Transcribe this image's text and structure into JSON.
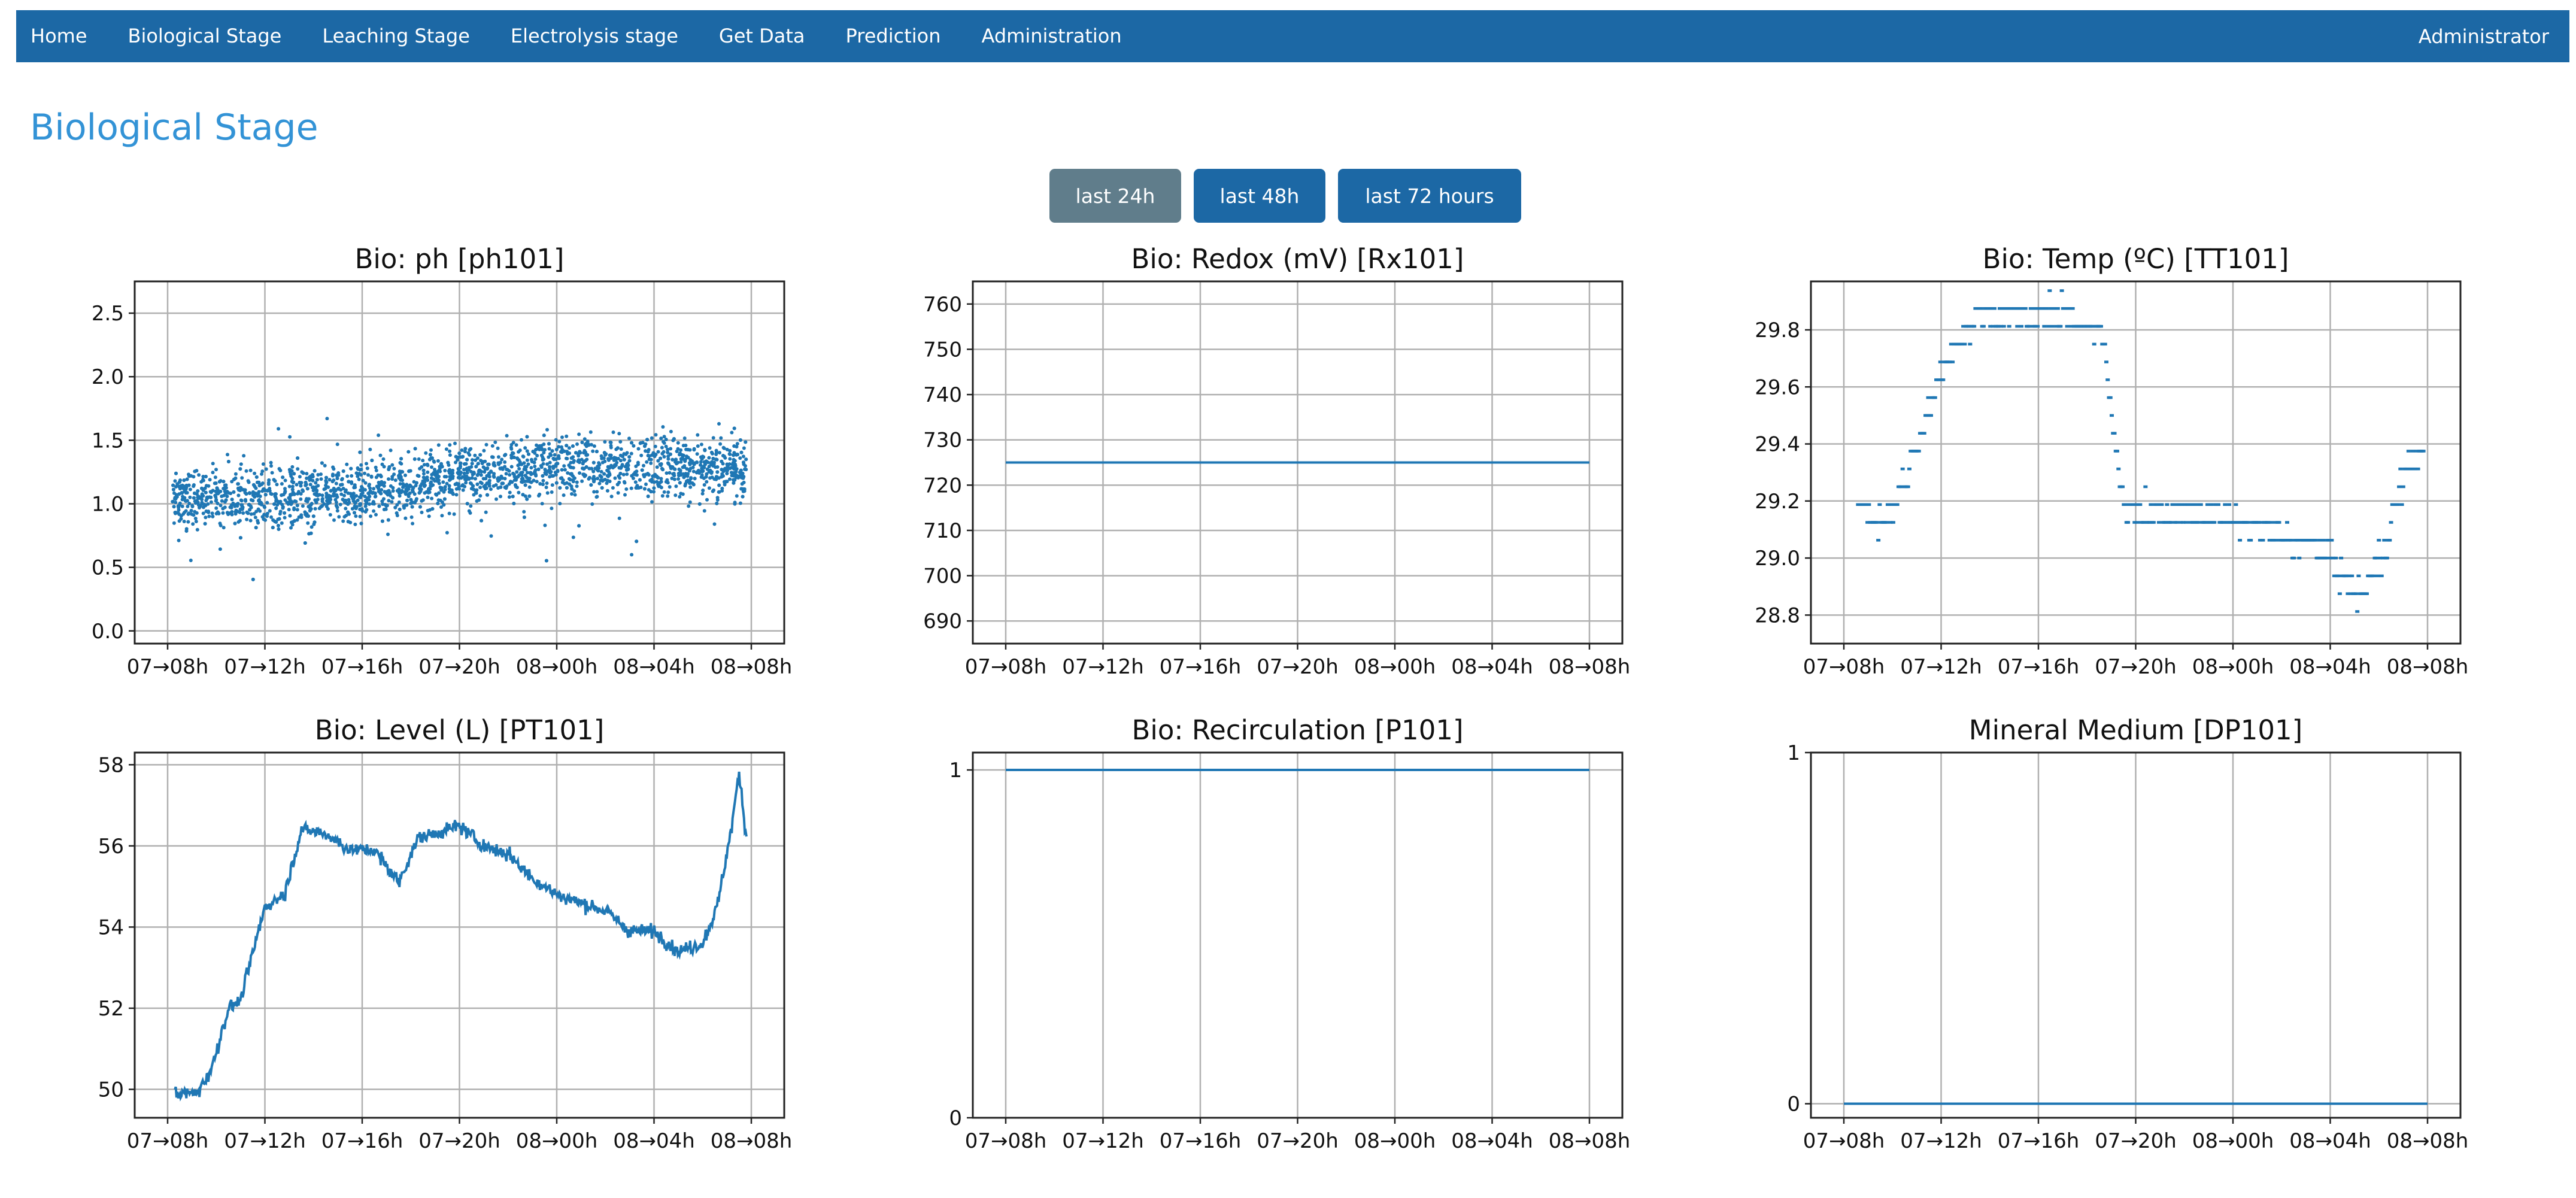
{
  "nav": {
    "items": [
      "Home",
      "Biological Stage",
      "Leaching Stage",
      "Electrolysis stage",
      "Get Data",
      "Prediction",
      "Administration"
    ],
    "user": "Administrator"
  },
  "page": {
    "title": "Biological Stage"
  },
  "range_buttons": {
    "b24": "last 24h",
    "b48": "last 48h",
    "b72": "last 72 hours"
  },
  "colors": {
    "navbar": "#1c68a5",
    "series": "#1f77b4",
    "title": "#3393d6",
    "inactive_button": "#607d8b"
  },
  "chart_data": [
    {
      "type": "scatter",
      "title": "Bio: ph [ph101]",
      "x_ticks": [
        "07→08h",
        "07→12h",
        "07→16h",
        "07→20h",
        "08→00h",
        "08→04h",
        "08→08h"
      ],
      "y_ticks": [
        "0.0",
        "0.5",
        "1.0",
        "1.5",
        "2.0",
        "2.5"
      ],
      "ylim": [
        -0.1,
        2.75
      ],
      "x_range_hours": [
        0,
        24
      ],
      "trend": [
        [
          0.2,
          1.05
        ],
        [
          4,
          1.05
        ],
        [
          8,
          1.1
        ],
        [
          12,
          1.2
        ],
        [
          16,
          1.3
        ],
        [
          20,
          1.3
        ],
        [
          23.8,
          1.25
        ]
      ],
      "spread": 0.3,
      "grid": true
    },
    {
      "type": "line",
      "title": "Bio: Redox (mV) [Rx101]",
      "x_ticks": [
        "07→08h",
        "07→12h",
        "07→16h",
        "07→20h",
        "08→00h",
        "08→04h",
        "08→08h"
      ],
      "y_ticks": [
        "690",
        "700",
        "710",
        "720",
        "730",
        "740",
        "750",
        "760"
      ],
      "ylim": [
        685,
        765
      ],
      "x_range_hours": [
        0,
        24
      ],
      "points": [
        [
          0,
          725
        ],
        [
          24,
          725
        ]
      ],
      "grid": true
    },
    {
      "type": "scatter",
      "title": "Bio: Temp (ºC) [TT101]",
      "x_ticks": [
        "07→08h",
        "07→12h",
        "07→16h",
        "07→20h",
        "08→00h",
        "08→04h",
        "08→08h"
      ],
      "y_ticks": [
        "28.8",
        "29.0",
        "29.2",
        "29.4",
        "29.6",
        "29.8"
      ],
      "ylim": [
        28.7,
        29.97
      ],
      "x_range_hours": [
        0,
        24
      ],
      "trend": [
        [
          0.5,
          29.2
        ],
        [
          1.5,
          29.1
        ],
        [
          2.5,
          29.3
        ],
        [
          3.5,
          29.55
        ],
        [
          4.5,
          29.75
        ],
        [
          5.5,
          29.85
        ],
        [
          7,
          29.85
        ],
        [
          9,
          29.85
        ],
        [
          10.5,
          29.8
        ],
        [
          11.2,
          29.3
        ],
        [
          11.5,
          29.18
        ],
        [
          13,
          29.15
        ],
        [
          15,
          29.15
        ],
        [
          17,
          29.1
        ],
        [
          19,
          29.05
        ],
        [
          20,
          29.0
        ],
        [
          21,
          28.85
        ],
        [
          22,
          29.0
        ],
        [
          23,
          29.3
        ],
        [
          23.8,
          29.4
        ]
      ],
      "step": 0.0625,
      "grid": true
    },
    {
      "type": "line",
      "title": "Bio: Level (L) [PT101]",
      "x_ticks": [
        "07→08h",
        "07→12h",
        "07→16h",
        "07→20h",
        "08→00h",
        "08→04h",
        "08→08h"
      ],
      "y_ticks": [
        "50",
        "52",
        "54",
        "56",
        "58"
      ],
      "ylim": [
        49.3,
        58.3
      ],
      "x_range_hours": [
        0,
        24
      ],
      "points": [
        [
          0.3,
          49.9
        ],
        [
          1.2,
          49.9
        ],
        [
          1.8,
          50.5
        ],
        [
          2.5,
          52.0
        ],
        [
          3,
          52.2
        ],
        [
          4,
          54.5
        ],
        [
          4.8,
          54.8
        ],
        [
          5.5,
          56.4
        ],
        [
          6.5,
          56.3
        ],
        [
          7.5,
          55.9
        ],
        [
          8.5,
          55.9
        ],
        [
          9.5,
          55.1
        ],
        [
          10.3,
          56.2
        ],
        [
          11,
          56.3
        ],
        [
          12,
          56.5
        ],
        [
          13,
          56.0
        ],
        [
          14,
          55.8
        ],
        [
          15,
          55.2
        ],
        [
          16,
          54.8
        ],
        [
          17,
          54.6
        ],
        [
          18,
          54.4
        ],
        [
          19,
          53.9
        ],
        [
          20,
          53.9
        ],
        [
          21,
          53.4
        ],
        [
          22,
          53.6
        ],
        [
          22.6,
          54.5
        ],
        [
          23.2,
          56.5
        ],
        [
          23.5,
          57.8
        ],
        [
          23.8,
          56.2
        ]
      ],
      "grid": true
    },
    {
      "type": "line",
      "title": "Bio: Recirculation [P101]",
      "x_ticks": [
        "07→08h",
        "07→12h",
        "07→16h",
        "07→20h",
        "08→00h",
        "08→04h",
        "08→08h"
      ],
      "y_ticks": [
        "0",
        "1"
      ],
      "ylim": [
        0,
        1.05
      ],
      "x_range_hours": [
        0,
        24
      ],
      "points": [
        [
          0,
          1
        ],
        [
          24,
          1
        ]
      ],
      "grid": true
    },
    {
      "type": "line",
      "title": "Mineral Medium [DP101]",
      "x_ticks": [
        "07→08h",
        "07→12h",
        "07→16h",
        "07→20h",
        "08→00h",
        "08→04h",
        "08→08h"
      ],
      "y_ticks": [
        "0",
        "1"
      ],
      "ylim": [
        -0.04,
        1.0
      ],
      "x_range_hours": [
        0,
        24
      ],
      "points": [
        [
          0,
          0
        ],
        [
          24,
          0
        ]
      ],
      "grid": true
    }
  ]
}
